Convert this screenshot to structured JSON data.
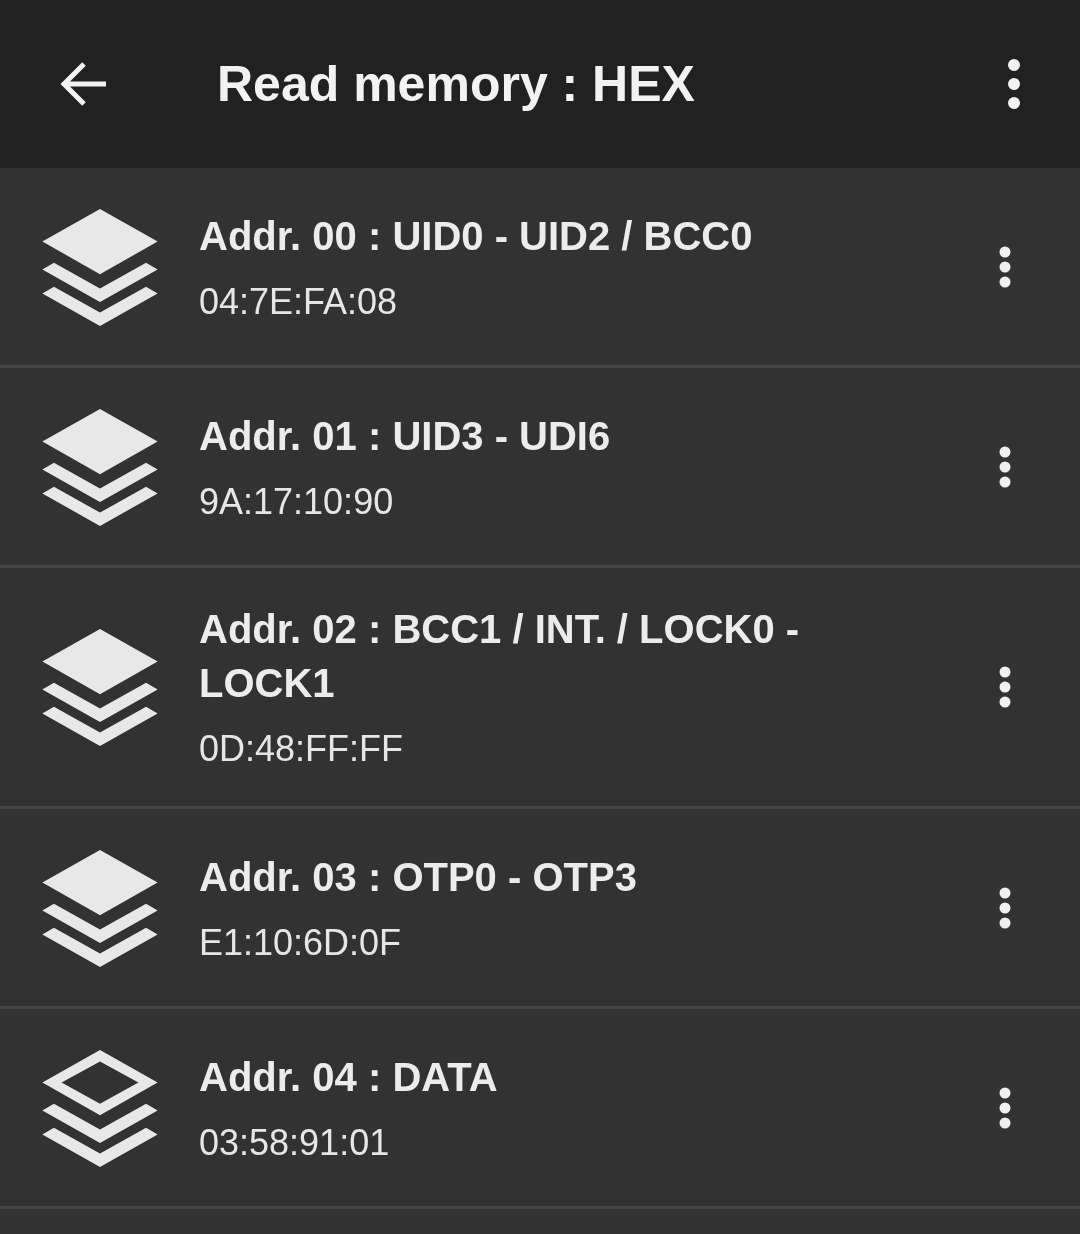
{
  "toolbar": {
    "title": "Read memory : HEX"
  },
  "items": [
    {
      "kind": "filled",
      "title": "Addr. 00 : UID0 - UID2 / BCC0",
      "value": "04:7E:FA:08"
    },
    {
      "kind": "filled",
      "title": "Addr. 01 : UID3 - UDI6",
      "value": "9A:17:10:90"
    },
    {
      "kind": "filled",
      "title": "Addr. 02 : BCC1 / INT. / LOCK0 - LOCK1",
      "value": "0D:48:FF:FF"
    },
    {
      "kind": "filled",
      "title": "Addr. 03 : OTP0 - OTP3",
      "value": "E1:10:6D:0F"
    },
    {
      "kind": "outline",
      "title": "Addr. 04 : DATA",
      "value": "03:58:91:01"
    }
  ]
}
